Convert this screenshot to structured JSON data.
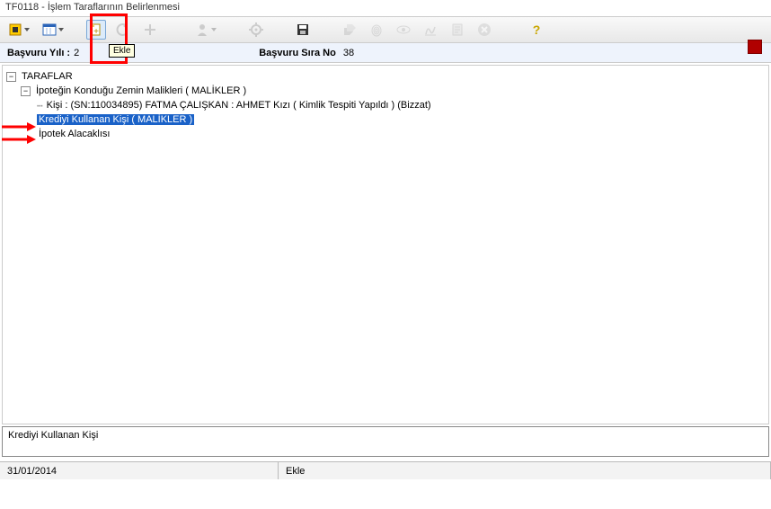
{
  "window": {
    "title": "TF0118 - İşlem Taraflarının Belirlenmesi"
  },
  "toolbar": {
    "tooltip_add": "Ekle",
    "icons": {
      "home": "home-icon",
      "cal": "calendar-icon",
      "add": "add-doc-icon",
      "undo": "undo-icon",
      "plus": "plus-icon",
      "person": "person-icon",
      "gear": "gear-icon",
      "save": "save-icon",
      "tags": "tags-icon",
      "finger": "finger-icon",
      "eye": "eye-icon",
      "sign": "sign-icon",
      "report": "report-icon",
      "close": "close-icon",
      "help": "help-icon"
    }
  },
  "info": {
    "yil_label": "Başvuru Yılı :",
    "yil_val": "2",
    "sirano_label": "Başvuru Sıra No",
    "sirano_val": "38"
  },
  "tree": {
    "root": "TARAFLAR",
    "n1": "İpoteğin Konduğu Zemin Malikleri ( MALİKLER )",
    "n1a": "Kişi : (SN:110034895) FATMA ÇALIŞKAN : AHMET Kızı ( Kimlik Tespiti Yapıldı ) (Bizzat)",
    "n2": "Krediyi Kullanan Kişi ( MALİKLER )",
    "n3": "İpotek Alacaklısı"
  },
  "status_text": "Krediyi Kullanan Kişi",
  "footer": {
    "date": "31/01/2014",
    "mode": "Ekle"
  }
}
